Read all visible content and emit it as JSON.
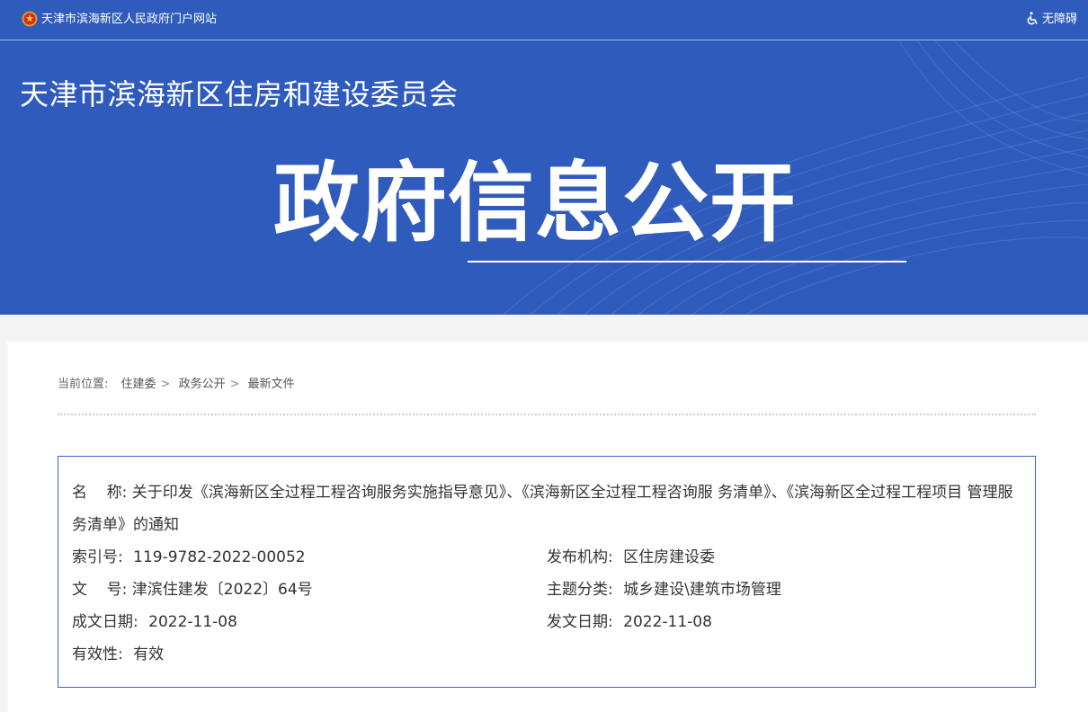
{
  "topbar": {
    "portal_link": "天津市滨海新区人民政府门户网站",
    "accessibility": "无障碍",
    "emblem_icon": "national-emblem-icon",
    "accessibility_icon": "wheelchair-icon"
  },
  "banner": {
    "department": "天津市滨海新区住房和建设委员会",
    "section_title": "政府信息公开"
  },
  "breadcrumb": {
    "label": "当前位置:",
    "items": [
      "住建委",
      "政务公开",
      "最新文件"
    ],
    "separator": ">"
  },
  "document": {
    "name_label": "名    称:",
    "name_value": "关于印发《滨海新区全过程工程咨询服务实施指导意见》、《滨海新区全过程工程咨询服 务清单》、《滨海新区全过程工程项目 管理服务清单》的通知",
    "index_label": "索引号:",
    "index_value": "119-9782-2022-00052",
    "publisher_label": "发布机构:",
    "publisher_value": "区住房建设委",
    "doc_no_label": "文    号:",
    "doc_no_value": "津滨住建发〔2022〕64号",
    "topic_label": "主题分类:",
    "topic_value": "城乡建设\\建筑市场管理",
    "created_label": "成文日期:",
    "created_value": "2022-11-08",
    "issued_label": "发文日期:",
    "issued_value": "2022-11-08",
    "validity_label": "有效性:",
    "validity_value": "有效"
  },
  "colors": {
    "brand_blue": "#2f5bbd",
    "box_border": "#3d62b3",
    "text": "#333333"
  }
}
